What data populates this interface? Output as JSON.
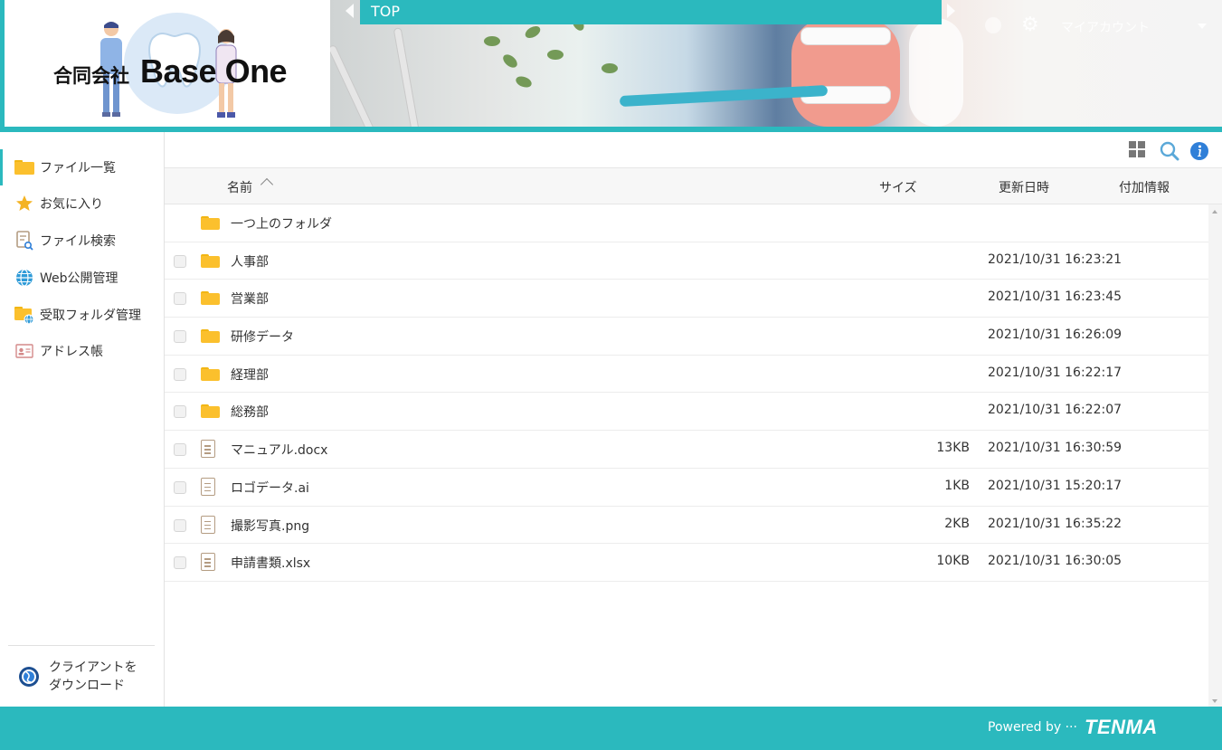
{
  "header": {
    "logo_corp": "合同会社",
    "logo_name": "Base One",
    "breadcrumb": "TOP",
    "account_label": "マイアカウント"
  },
  "sidebar": {
    "items": [
      {
        "label": "ファイル一覧",
        "icon": "folder-icon",
        "active": true
      },
      {
        "label": "お気に入り",
        "icon": "star-icon"
      },
      {
        "label": "ファイル検索",
        "icon": "file-search-icon"
      },
      {
        "label": "Web公開管理",
        "icon": "globe-icon"
      },
      {
        "label": "受取フォルダ管理",
        "icon": "folder-globe-icon"
      },
      {
        "label": "アドレス帳",
        "icon": "address-card-icon"
      }
    ],
    "client_download": {
      "line1": "クライアントを",
      "line2": "ダウンロード"
    }
  },
  "toolbar": {
    "icons": [
      "grid-view-icon",
      "search-icon",
      "info-icon"
    ]
  },
  "table": {
    "columns": {
      "name": "名前",
      "size": "サイズ",
      "updated": "更新日時",
      "extra": "付加情報"
    },
    "parent_folder": "一つ上のフォルダ",
    "rows": [
      {
        "type": "folder",
        "name": "人事部",
        "size": "",
        "date": "2021/10/31 16:23:21"
      },
      {
        "type": "folder",
        "name": "営業部",
        "size": "",
        "date": "2021/10/31 16:23:45"
      },
      {
        "type": "folder",
        "name": "研修データ",
        "size": "",
        "date": "2021/10/31 16:26:09"
      },
      {
        "type": "folder",
        "name": "経理部",
        "size": "",
        "date": "2021/10/31 16:22:17"
      },
      {
        "type": "folder",
        "name": "総務部",
        "size": "",
        "date": "2021/10/31 16:22:07"
      },
      {
        "type": "file",
        "name": "マニュアル.docx",
        "size": "13KB",
        "date": "2021/10/31 16:30:59"
      },
      {
        "type": "file",
        "name": "ロゴデータ.ai",
        "size": "1KB",
        "date": "2021/10/31 15:20:17"
      },
      {
        "type": "file",
        "name": "撮影写真.png",
        "size": "2KB",
        "date": "2021/10/31 16:35:22"
      },
      {
        "type": "file",
        "name": "申請書類.xlsx",
        "size": "10KB",
        "date": "2021/10/31 16:30:05"
      }
    ]
  },
  "footer": {
    "powered_by": "Powered by ···",
    "brand": "TENMA"
  },
  "colors": {
    "accent": "#2bb9be",
    "folder": "#fbc02d",
    "info": "#2f7fd8"
  }
}
